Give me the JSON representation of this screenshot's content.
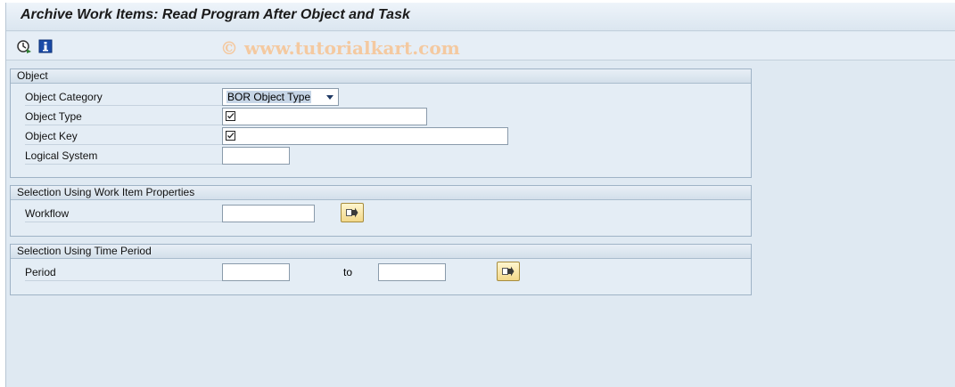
{
  "title": "Archive Work Items: Read Program After Object and Task",
  "watermark": "© www.tutorialkart.com",
  "toolbar": {
    "icons": [
      "execute-clock-icon",
      "info-icon"
    ]
  },
  "object_group": {
    "header": "Object",
    "category_label": "Object Category",
    "category_value": "BOR Object Type",
    "type_label": "Object Type",
    "type_value": "",
    "key_label": "Object Key",
    "key_value": "",
    "logsys_label": "Logical System",
    "logsys_value": ""
  },
  "workflow_group": {
    "header": "Selection Using Work Item Properties",
    "workflow_label": "Workflow",
    "workflow_value": ""
  },
  "period_group": {
    "header": "Selection Using Time Period",
    "period_label": "Period",
    "from_value": "",
    "to_label": "to",
    "to_value": ""
  },
  "colors": {
    "background": "#dfe9f2",
    "group_border": "#9fb3c6",
    "exec_button": "#f2d88a",
    "watermark": "#f4c9a0"
  }
}
